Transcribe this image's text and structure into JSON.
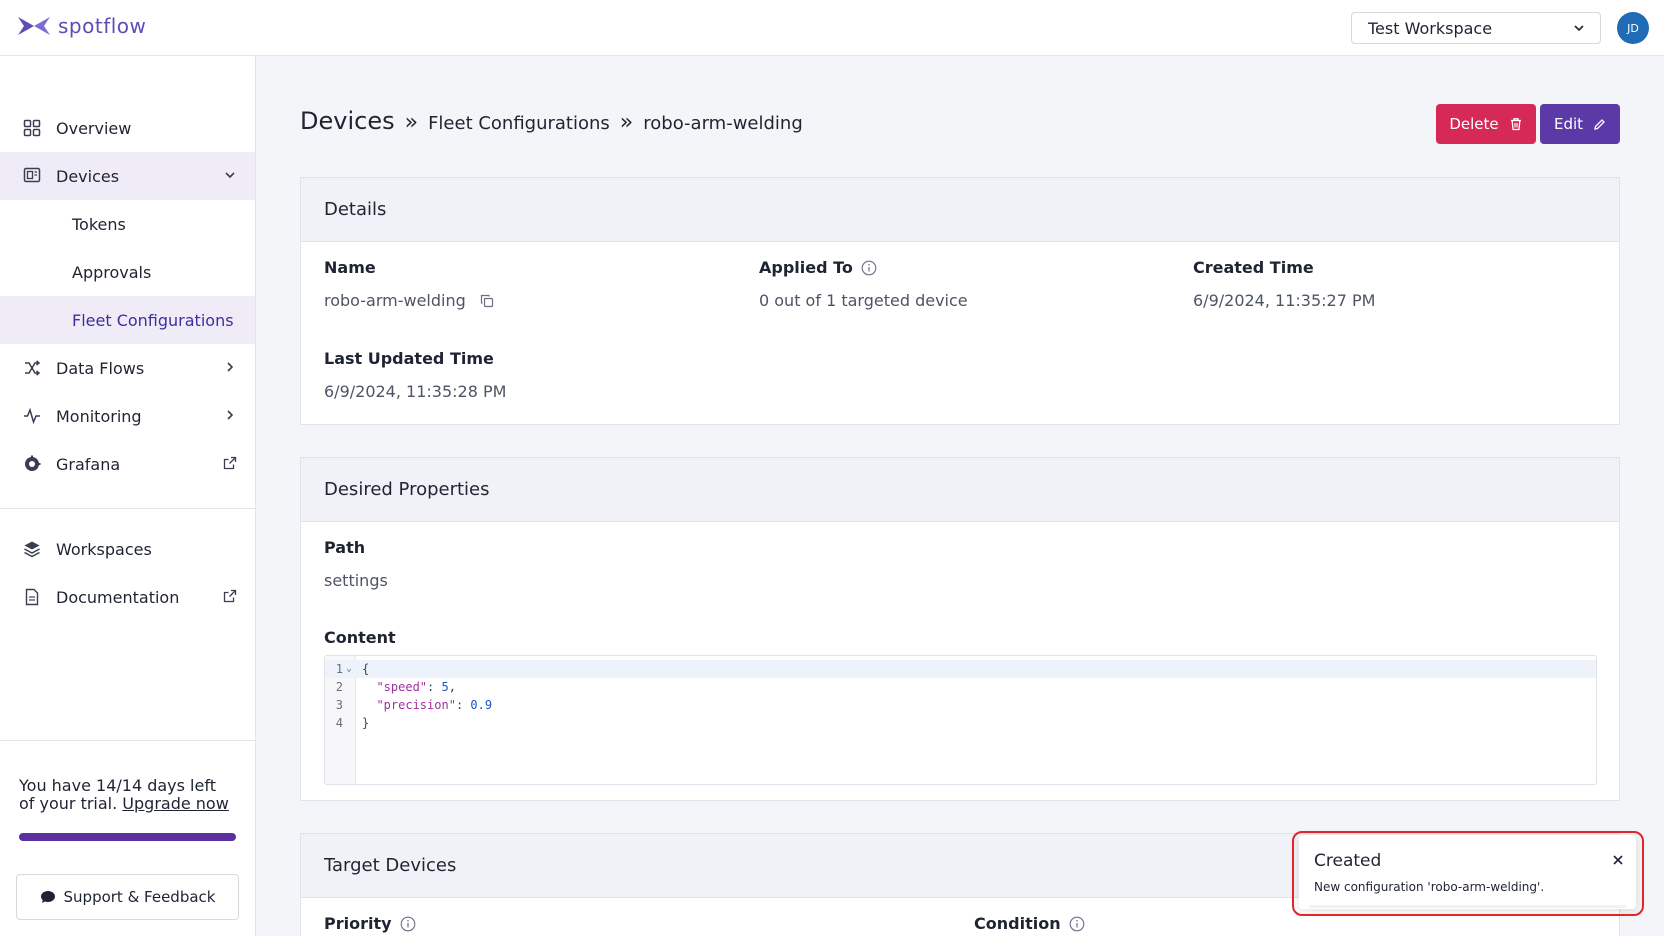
{
  "header": {
    "logo_text": "spotflow",
    "workspace_select": "Test Workspace",
    "avatar_initials": "JD"
  },
  "sidebar": {
    "items": [
      {
        "label": "Overview",
        "icon": "grid-icon"
      },
      {
        "label": "Devices",
        "icon": "devices-icon"
      },
      {
        "label": "Tokens"
      },
      {
        "label": "Approvals"
      },
      {
        "label": "Fleet Configurations"
      },
      {
        "label": "Data Flows",
        "icon": "shuffle-icon"
      },
      {
        "label": "Monitoring",
        "icon": "activity-icon"
      },
      {
        "label": "Grafana",
        "icon": "grafana-icon"
      },
      {
        "label": "Workspaces",
        "icon": "layers-icon"
      },
      {
        "label": "Documentation",
        "icon": "document-icon"
      }
    ],
    "trial_text": "You have 14/14 days left of your trial.",
    "trial_link": "Upgrade now",
    "trial_progress": 1.0,
    "support_button": "Support & Feedback"
  },
  "breadcrumb": {
    "root": "Devices",
    "level1": "Fleet Configurations",
    "level2": "robo-arm-welding"
  },
  "actions": {
    "delete": "Delete",
    "edit": "Edit"
  },
  "details": {
    "title": "Details",
    "name_label": "Name",
    "name_value": "robo-arm-welding",
    "applied_label": "Applied To",
    "applied_value": "0 out of 1 targeted device",
    "created_label": "Created Time",
    "created_value": "6/9/2024, 11:35:27 PM",
    "updated_label": "Last Updated Time",
    "updated_value": "6/9/2024, 11:35:28 PM"
  },
  "desired": {
    "title": "Desired Properties",
    "path_label": "Path",
    "path_value": "settings",
    "content_label": "Content",
    "lines": [
      {
        "num": "1",
        "text": "{"
      },
      {
        "num": "2",
        "key": "\"speed\"",
        "value": "5",
        "trail": ","
      },
      {
        "num": "3",
        "key": "\"precision\"",
        "value": "0.9",
        "trail": ""
      },
      {
        "num": "4",
        "text": "}"
      }
    ]
  },
  "target": {
    "title": "Target Devices",
    "priority_label": "Priority",
    "condition_label": "Condition"
  },
  "toast": {
    "title": "Created",
    "message": "New configuration 'robo-arm-welding'."
  },
  "colors": {
    "brand": "#5b4fb5",
    "delete": "#d62957",
    "edit": "#5b3aa8",
    "active_bg": "#efecf8"
  }
}
